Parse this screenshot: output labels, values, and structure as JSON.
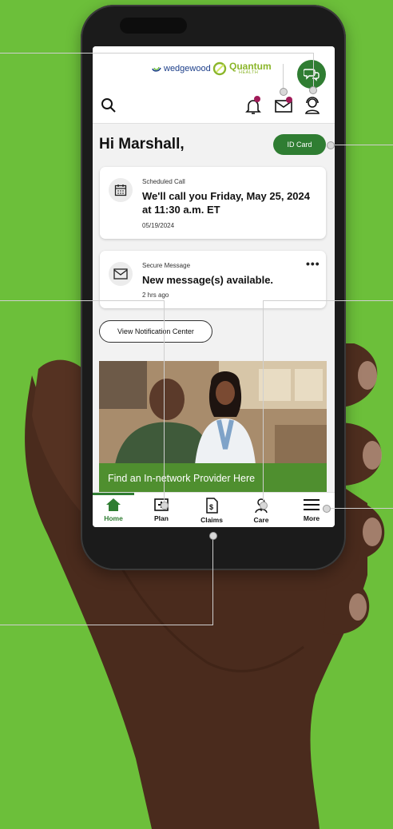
{
  "brand": {
    "partner_name": "wedgewood",
    "quantum_name": "Quantum",
    "quantum_sub": "HEALTH"
  },
  "header": {
    "greeting": "Hi Marshall,",
    "id_card_label": "ID Card"
  },
  "cards": [
    {
      "label": "Scheduled Call",
      "title": "We'll call you Friday, May 25, 2024 at 11:30 a.m. ET",
      "sub": "05/19/2024",
      "icon": "calendar-icon"
    },
    {
      "label": "Secure Message",
      "title": "New message(s) available.",
      "sub": "2 hrs ago",
      "icon": "envelope-icon",
      "more": "•••"
    }
  ],
  "notification_button": "View Notification Center",
  "promo": {
    "banner_text": "Find an In-network Provider Here"
  },
  "tabs": [
    {
      "label": "Home",
      "icon": "home-icon"
    },
    {
      "label": "Plan",
      "icon": "medical-plan-icon"
    },
    {
      "label": "Claims",
      "icon": "claims-document-icon"
    },
    {
      "label": "Care",
      "icon": "care-person-icon"
    },
    {
      "label": "More",
      "icon": "menu-icon"
    }
  ],
  "colors": {
    "background": "#6cbf3a",
    "primary_green": "#2f7d32",
    "notification_dot": "#a01a58",
    "quantum_green": "#8bb62a"
  }
}
